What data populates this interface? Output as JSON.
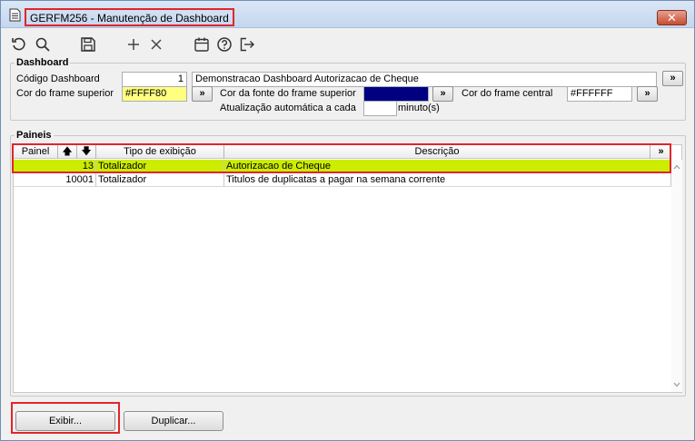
{
  "window": {
    "title": "GERFM256 - Manutenção de Dashboard",
    "close_label": "✕"
  },
  "toolbar": {
    "icons": [
      "refresh-icon",
      "search-icon",
      "save-icon",
      "add-icon",
      "delete-icon",
      "calendar-icon",
      "help-icon",
      "exit-icon"
    ]
  },
  "dashboard": {
    "group_label": "Dashboard",
    "codigo_label": "Código Dashboard",
    "codigo_value": "1",
    "descricao_value": "Demonstracao Dashboard Autorizacao de Cheque",
    "cor_frame_superior_label": "Cor do frame superior",
    "cor_frame_superior_value": "#FFFF80",
    "cor_fonte_label": "Cor da fonte do frame superior",
    "cor_fonte_value": "#000080",
    "cor_frame_central_label": "Cor do frame central",
    "cor_frame_central_value": "#FFFFFF",
    "atualizacao_label": "Atualização automática a cada",
    "atualizacao_value": "",
    "minutos_label": "minuto(s)",
    "lookup_label": "»"
  },
  "paineis": {
    "group_label": "Paineis",
    "columns": {
      "painel": "Painel",
      "up": "🡅",
      "down": "🡇",
      "tipo": "Tipo de exibição",
      "descricao": "Descrição",
      "more": "»"
    },
    "rows": [
      {
        "painel": "13",
        "tipo": "Totalizador",
        "descricao": "Autorizacao de Cheque"
      },
      {
        "painel": "10001",
        "tipo": "Totalizador",
        "descricao": "Titulos de duplicatas a pagar na semana corrente"
      }
    ]
  },
  "buttons": {
    "exibir": "Exibir...",
    "duplicar": "Duplicar..."
  },
  "colors": {
    "selected_row": "#CCEC00",
    "frame_superior": "#FFFF80",
    "fonte_frame": "#000080",
    "highlight": "#E0262A"
  }
}
